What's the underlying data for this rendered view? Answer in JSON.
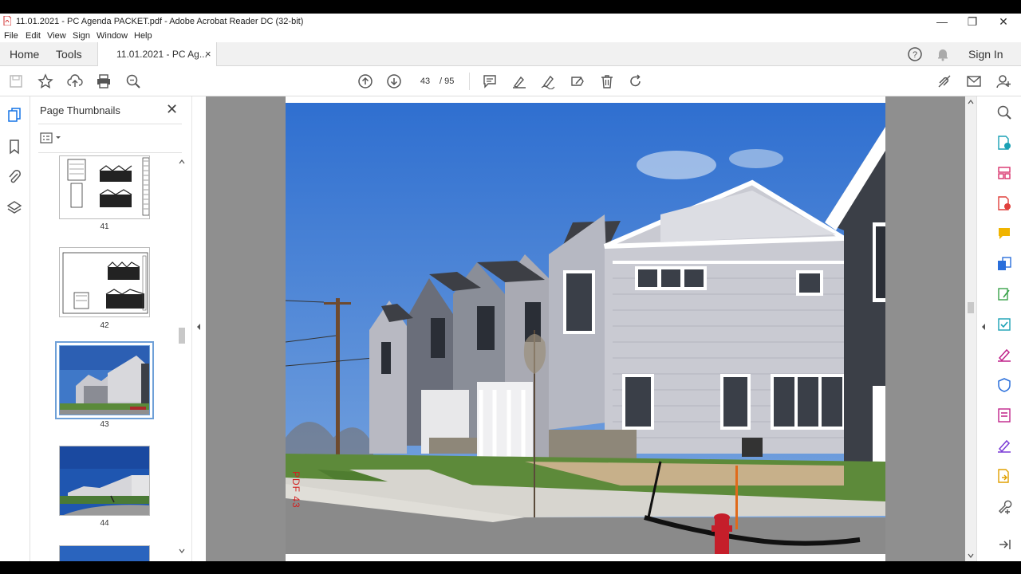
{
  "window": {
    "title": "11.01.2021 - PC Agenda PACKET.pdf - Adobe Acrobat Reader DC (32-bit)",
    "minimize": "—",
    "restore": "❐",
    "close": "✕"
  },
  "menu": [
    "File",
    "Edit",
    "View",
    "Sign",
    "Window",
    "Help"
  ],
  "tabs": {
    "home": "Home",
    "tools": "Tools",
    "document": "11.01.2021 - PC Ag...",
    "document_close": "×",
    "sign_in": "Sign In"
  },
  "toolbar": {
    "current_page": "43",
    "total_pages": "/ 95"
  },
  "thumbnails_panel": {
    "title": "Page Thumbnails",
    "close": "✕",
    "pages": [
      {
        "number": "41"
      },
      {
        "number": "42"
      },
      {
        "number": "43",
        "selected": true
      },
      {
        "number": "44"
      }
    ]
  },
  "document": {
    "stamp": "PDF 43"
  },
  "colors": {
    "accent": "#1473e6",
    "selection": "#6ea0d8"
  }
}
